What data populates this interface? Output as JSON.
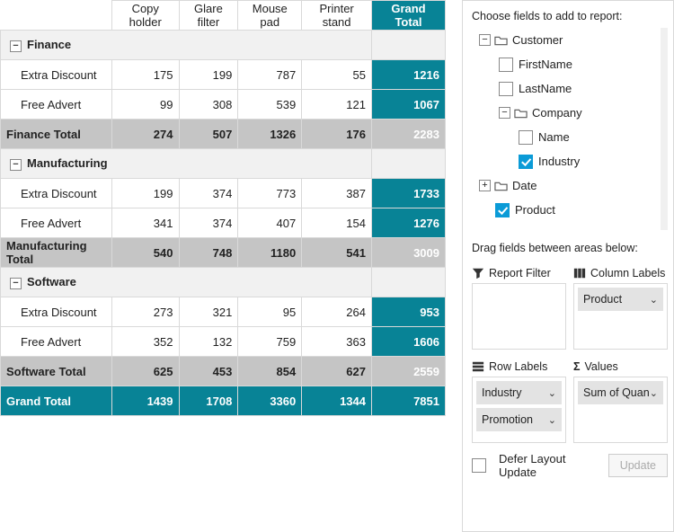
{
  "chart_data": {
    "type": "table",
    "columns": [
      "Copy holder",
      "Glare filter",
      "Mouse pad",
      "Printer stand",
      "Grand Total"
    ],
    "rows": [
      {
        "group": "Finance",
        "row": "Extra Discount",
        "values": [
          175,
          199,
          787,
          55,
          1216
        ]
      },
      {
        "group": "Finance",
        "row": "Free Advert",
        "values": [
          99,
          308,
          539,
          121,
          1067
        ]
      },
      {
        "group": "Finance",
        "row": "Finance Total",
        "values": [
          274,
          507,
          1326,
          176,
          2283
        ]
      },
      {
        "group": "Manufacturing",
        "row": "Extra Discount",
        "values": [
          199,
          374,
          773,
          387,
          1733
        ]
      },
      {
        "group": "Manufacturing",
        "row": "Free Advert",
        "values": [
          341,
          374,
          407,
          154,
          1276
        ]
      },
      {
        "group": "Manufacturing",
        "row": "Manufacturing Total",
        "values": [
          540,
          748,
          1180,
          541,
          3009
        ]
      },
      {
        "group": "Software",
        "row": "Extra Discount",
        "values": [
          273,
          321,
          95,
          264,
          953
        ]
      },
      {
        "group": "Software",
        "row": "Free Advert",
        "values": [
          352,
          132,
          759,
          363,
          1606
        ]
      },
      {
        "group": "Software",
        "row": "Software Total",
        "values": [
          625,
          453,
          854,
          627,
          2559
        ]
      }
    ],
    "grand_total": {
      "label": "Grand Total",
      "values": [
        1439,
        1708,
        3360,
        1344,
        7851
      ]
    }
  },
  "pivot": {
    "columns": [
      "Copy holder",
      "Glare filter",
      "Mouse pad",
      "Printer stand"
    ],
    "grand_total_label": "Grand Total",
    "groups": [
      {
        "name": "Finance",
        "rows": [
          {
            "label": "Extra Discount",
            "v": [
              175,
              199,
              787,
              55
            ],
            "t": 1216
          },
          {
            "label": "Free Advert",
            "v": [
              99,
              308,
              539,
              121
            ],
            "t": 1067
          }
        ],
        "subtotal_label": "Finance Total",
        "subtotal": [
          274,
          507,
          1326,
          176
        ],
        "subtotal_t": 2283
      },
      {
        "name": "Manufacturing",
        "rows": [
          {
            "label": "Extra Discount",
            "v": [
              199,
              374,
              773,
              387
            ],
            "t": 1733
          },
          {
            "label": "Free Advert",
            "v": [
              341,
              374,
              407,
              154
            ],
            "t": 1276
          }
        ],
        "subtotal_label": "Manufacturing Total",
        "subtotal": [
          540,
          748,
          1180,
          541
        ],
        "subtotal_t": 3009
      },
      {
        "name": "Software",
        "rows": [
          {
            "label": "Extra Discount",
            "v": [
              273,
              321,
              95,
              264
            ],
            "t": 953
          },
          {
            "label": "Free Advert",
            "v": [
              352,
              132,
              759,
              363
            ],
            "t": 1606
          }
        ],
        "subtotal_label": "Software Total",
        "subtotal": [
          625,
          453,
          854,
          627
        ],
        "subtotal_t": 2559
      }
    ],
    "grand": {
      "label": "Grand Total",
      "v": [
        1439,
        1708,
        3360,
        1344
      ],
      "t": 7851
    }
  },
  "panel": {
    "choose_label": "Choose fields to add to report:",
    "tree": {
      "customer": "Customer",
      "firstname": "FirstName",
      "lastname": "LastName",
      "company": "Company",
      "name": "Name",
      "industry": "Industry",
      "date": "Date",
      "product": "Product"
    },
    "drag_label": "Drag fields between areas below:",
    "areas": {
      "filter": "Report Filter",
      "columns": "Column Labels",
      "rows": "Row Labels",
      "values": "Values"
    },
    "chips": {
      "product": "Product",
      "industry": "Industry",
      "promotion": "Promotion",
      "sumqty": "Sum of Quan"
    },
    "defer_label": "Defer Layout Update",
    "update_btn": "Update"
  }
}
